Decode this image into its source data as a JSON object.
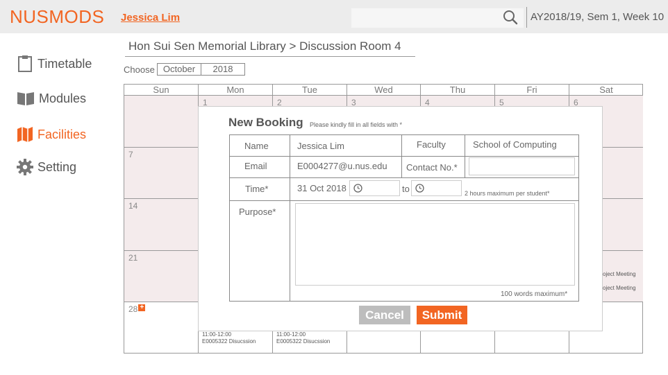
{
  "app": {
    "logo": "NUSMODS",
    "user": "Jessica Lim",
    "term": "AY2018/19, Sem 1, Week 10",
    "accent": "#f26522"
  },
  "sidebar": {
    "items": [
      {
        "label": "Timetable",
        "icon": "clipboard-icon",
        "active": false
      },
      {
        "label": "Modules",
        "icon": "book-icon",
        "active": false
      },
      {
        "label": "Facilities",
        "icon": "map-icon",
        "active": true
      },
      {
        "label": "Setting",
        "icon": "gear-icon",
        "active": false
      }
    ]
  },
  "breadcrumb": "Hon Sui Sen Memorial Library > Discussion Room 4",
  "chooser": {
    "label": "Choose",
    "month": "October",
    "year": "2018"
  },
  "calendar": {
    "days": [
      "Sun",
      "Mon",
      "Tue",
      "Wed",
      "Thu",
      "Fri",
      "Sat"
    ],
    "dates": [
      "",
      "1",
      "2",
      "3",
      "4",
      "5",
      "6",
      "7",
      "14",
      "21",
      "28"
    ],
    "events": {
      "sat_1": "oject Meeting",
      "sat_2": "oject Meeting",
      "mon_28_time": "11:00-12:00",
      "mon_28_desc": "E0005322 Disucssion",
      "tue_28_time": "11:00-12:00",
      "tue_28_desc": "E0005322 Disucssion"
    }
  },
  "modal": {
    "title": "New Booking",
    "hint": "Please kindly fill in all fields with *",
    "name_label": "Name",
    "name_value": "Jessica Lim",
    "faculty_label": "Faculty",
    "faculty_value": "School of Computing",
    "email_label": "Email",
    "email_value": "E0004277@u.nus.edu",
    "contact_label": "Contact No.*",
    "contact_value": "",
    "time_label": "Time*",
    "date_value": "31 Oct 2018",
    "to_label": "to",
    "time_hint": "2 hours maximum per student*",
    "purpose_label": "Purpose*",
    "purpose_value": "",
    "purpose_hint": "100 words maximum*",
    "cancel": "Cancel",
    "submit": "Submit"
  }
}
